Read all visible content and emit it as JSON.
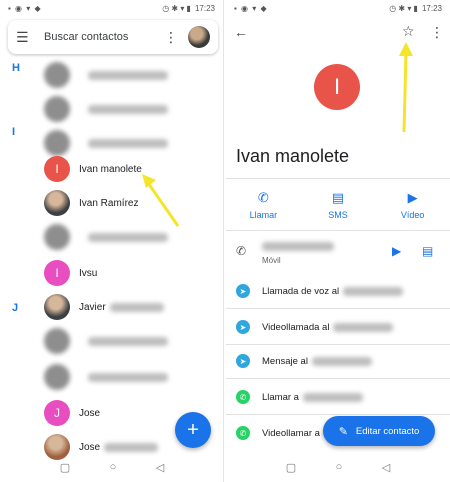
{
  "status": {
    "time": "17:23",
    "left_icons": "▪ ◉ ▾ ◆",
    "right_icons": "◷ ✱ ▾ ▮"
  },
  "left": {
    "search": {
      "placeholder": "Buscar contactos",
      "menu_icon": "☰",
      "more_icon": "⋮"
    },
    "letters": [
      "H",
      "I",
      "J"
    ],
    "contacts": [
      {
        "initial": "",
        "name": "",
        "blurred": true,
        "color": "#8e8e8e"
      },
      {
        "initial": "",
        "name": "",
        "blurred": true,
        "color": "#8e8e8e"
      },
      {
        "initial": "",
        "name": "",
        "blurred": true,
        "color": "#8e8e8e"
      },
      {
        "initial": "I",
        "name": "Ivan manolete",
        "blurred": false,
        "color": "#e8534a"
      },
      {
        "initial": "",
        "name": "Ivan Ramírez",
        "blurred": false,
        "color": "#3c4043",
        "photo": true
      },
      {
        "initial": "",
        "name": "",
        "blurred": true,
        "color": "#8e8e8e"
      },
      {
        "initial": "I",
        "name": "Ivsu",
        "blurred": false,
        "color": "#e84ec0"
      },
      {
        "initial": "",
        "name": "Javier",
        "blurred": false,
        "color": "#3c4043",
        "photo": true
      },
      {
        "initial": "",
        "name": "",
        "blurred": true,
        "color": "#8e8e8e"
      },
      {
        "initial": "",
        "name": "",
        "blurred": true,
        "color": "#8e8e8e"
      },
      {
        "initial": "J",
        "name": "Jose",
        "blurred": false,
        "color": "#e84ec0"
      },
      {
        "initial": "",
        "name": "Jose",
        "blurred": false,
        "color": "#a06040",
        "photo": true
      }
    ],
    "fab_icon": "+",
    "nav": {
      "square": "▢",
      "circle": "○",
      "back": "◁"
    }
  },
  "right": {
    "back_icon": "←",
    "star_icon": "☆",
    "more_icon": "⋮",
    "avatar_initial": "I",
    "name": "Ivan manolete",
    "actions": [
      {
        "icon": "✆",
        "label": "Llamar"
      },
      {
        "icon": "▤",
        "label": "SMS"
      },
      {
        "icon": "▶",
        "label": "Vídeo"
      }
    ],
    "phone": {
      "icon": "✆",
      "type": "Móvil",
      "video_icon": "▶",
      "msg_icon": "▤"
    },
    "apps": [
      {
        "kind": "tg",
        "icon": "➤",
        "text": "Llamada de voz al"
      },
      {
        "kind": "tg",
        "icon": "➤",
        "text": "Videollamada al"
      },
      {
        "kind": "tg",
        "icon": "➤",
        "text": "Mensaje al"
      },
      {
        "kind": "wa",
        "icon": "✆",
        "text": "Llamar a"
      },
      {
        "kind": "wa",
        "icon": "✆",
        "text": "Videollamar a"
      }
    ],
    "edit_label": "Editar contacto",
    "edit_icon": "✎",
    "nav": {
      "square": "▢",
      "circle": "○",
      "back": "◁"
    }
  },
  "colors": {
    "accent": "#1a73e8",
    "arrow": "#f5e52a"
  }
}
